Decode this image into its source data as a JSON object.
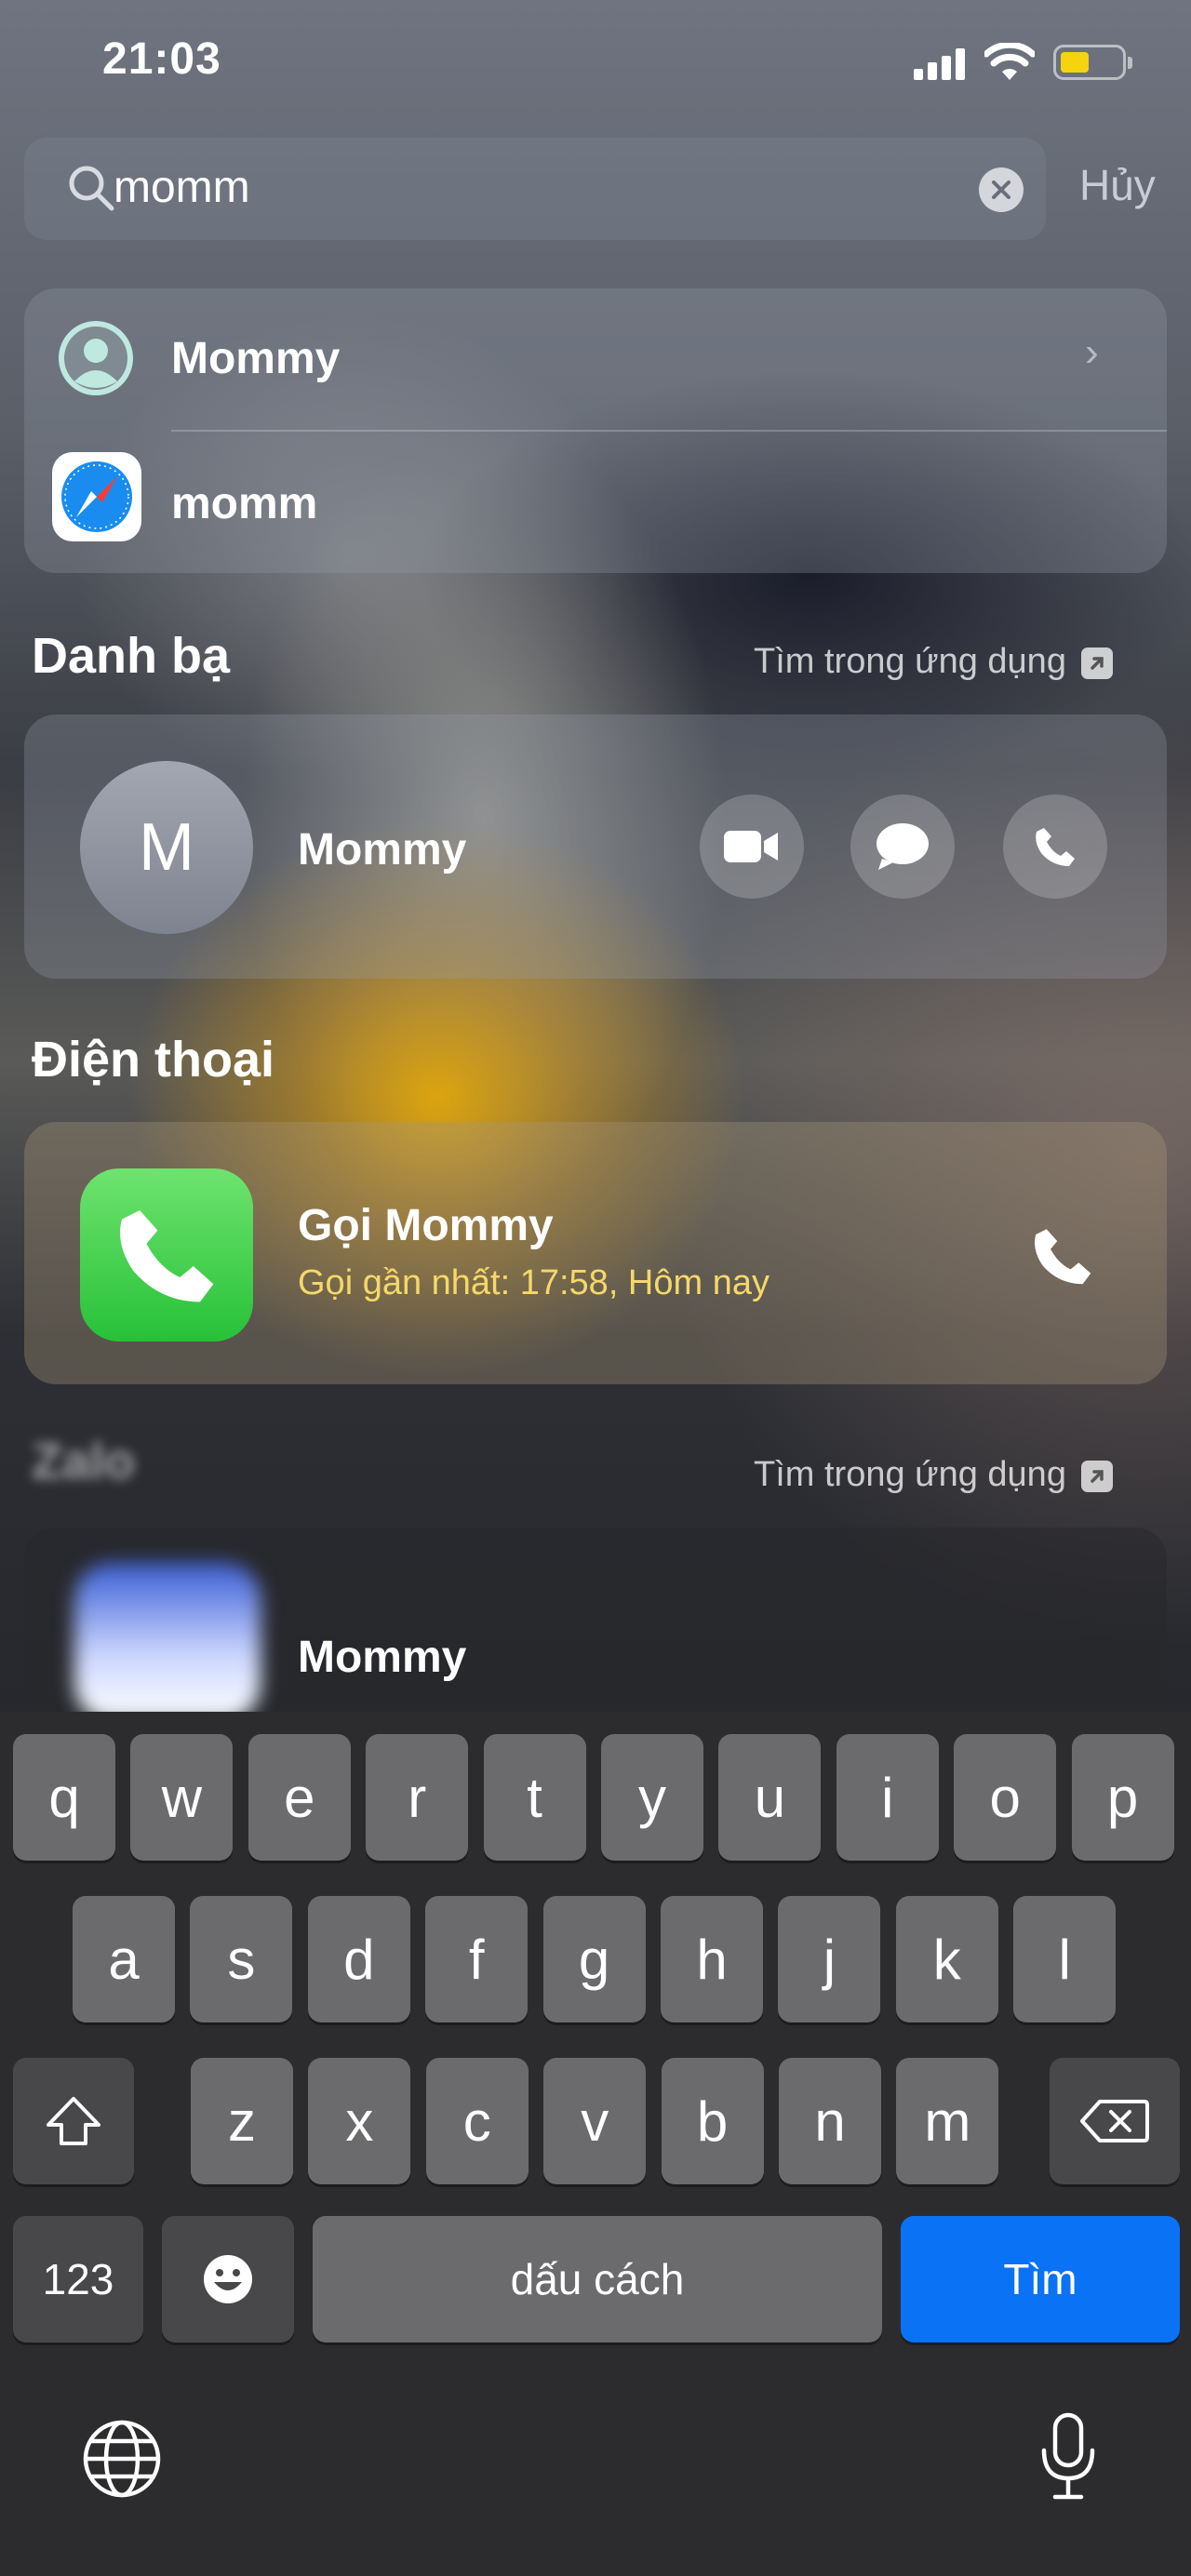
{
  "status_bar": {
    "time": "21:03"
  },
  "search": {
    "query": "momm",
    "cancel_label": "Hủy"
  },
  "top_hits": [
    {
      "label": "Mommy",
      "icon": "contact-icon"
    },
    {
      "label": "momm",
      "icon": "safari-icon"
    }
  ],
  "contacts_section": {
    "title": "Danh bạ",
    "link": "Tìm trong ứng dụng",
    "contact": {
      "initial": "M",
      "name": "Mommy"
    }
  },
  "phone_section": {
    "title": "Điện thoại",
    "call_title": "Gọi Mommy",
    "call_subtitle": "Gọi gần nhất: 17:58, Hôm nay"
  },
  "third_section": {
    "link": "Tìm trong ứng dụng",
    "item_label": "Mommy"
  },
  "keyboard": {
    "row1": [
      "q",
      "w",
      "e",
      "r",
      "t",
      "y",
      "u",
      "i",
      "o",
      "p"
    ],
    "row2": [
      "a",
      "s",
      "d",
      "f",
      "g",
      "h",
      "j",
      "k",
      "l"
    ],
    "row3": [
      "z",
      "x",
      "c",
      "v",
      "b",
      "n",
      "m"
    ],
    "numbers_label": "123",
    "space_label": "dấu cách",
    "search_label": "Tìm"
  },
  "colors": {
    "accent": "#0a72f5",
    "battery": "#f5d30e",
    "phone_green": "#27c138"
  }
}
